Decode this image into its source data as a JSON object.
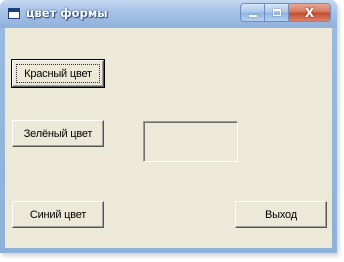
{
  "window": {
    "title": "цвет формы",
    "controls": {
      "minimize": "minimize",
      "maximize": "maximize",
      "close_glyph": "X"
    }
  },
  "buttons": {
    "red_label": "Красный цвет",
    "green_label": "Зелёный цвет",
    "blue_label": "Синий цвет",
    "exit_label": "Выход"
  },
  "icons": {
    "app": "form-window-icon",
    "minimize": "minimize-icon",
    "maximize": "maximize-icon",
    "close": "close-icon"
  },
  "colors": {
    "titlebar": "#9bbbe0",
    "client": "#ece9d8",
    "close_button": "#c24a2e"
  }
}
